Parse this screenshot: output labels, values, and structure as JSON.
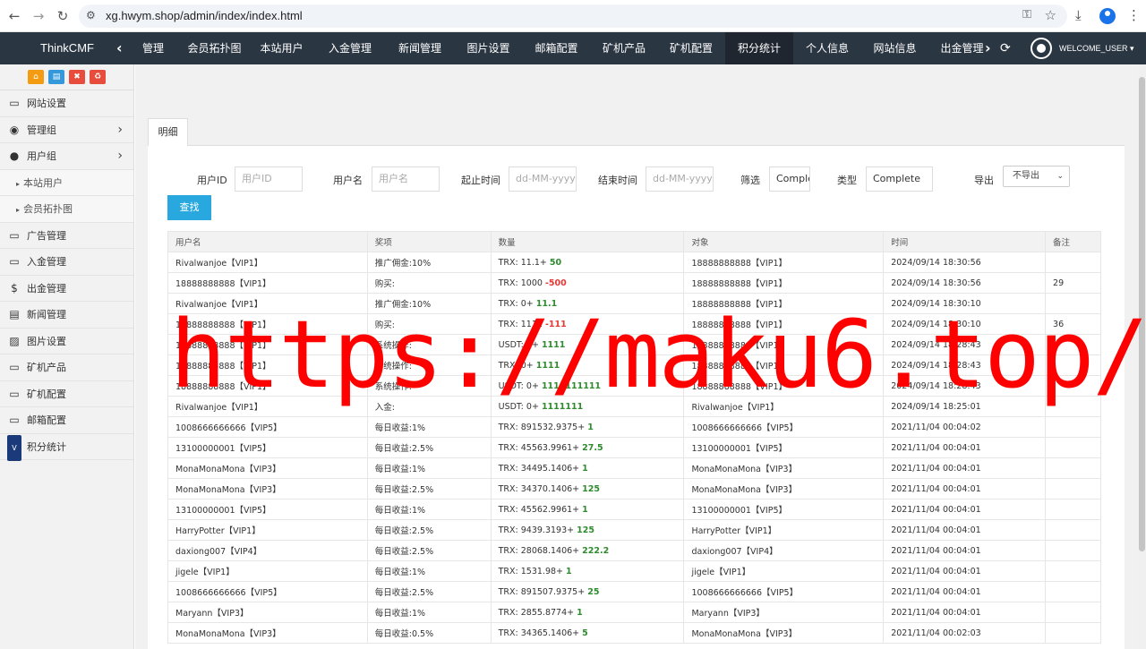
{
  "browser": {
    "url": "xg.hwym.shop/admin/index/index.html"
  },
  "topnav": {
    "brand": "ThinkCMF",
    "items": [
      {
        "label": "管理"
      },
      {
        "label": "会员拓扑图"
      },
      {
        "label": "本站用户"
      },
      {
        "label": "入金管理"
      },
      {
        "label": "新闻管理"
      },
      {
        "label": "图片设置"
      },
      {
        "label": "邮箱配置"
      },
      {
        "label": "矿机产品"
      },
      {
        "label": "矿机配置"
      },
      {
        "label": "积分统计",
        "active": true
      },
      {
        "label": "个人信息"
      },
      {
        "label": "网站信息"
      },
      {
        "label": "出金管理"
      }
    ],
    "welcome": "WELCOME_USER ▾"
  },
  "sidebar": {
    "quick_icons": [
      {
        "name": "home-icon",
        "color": "#f39c12",
        "glyph": "⌂"
      },
      {
        "name": "document-icon",
        "color": "#3498db",
        "glyph": "▤"
      },
      {
        "name": "trash-icon",
        "color": "#e74c3c",
        "glyph": "✖"
      },
      {
        "name": "recycle-icon",
        "color": "#e74c3c",
        "glyph": "♻"
      }
    ],
    "items": [
      {
        "label": "网站设置",
        "icon": "monitor-icon"
      },
      {
        "label": "管理组",
        "icon": "user-circle-icon"
      },
      {
        "label": "用户组",
        "icon": "user-icon"
      },
      {
        "label": "本站用户"
      },
      {
        "label": "会员拓扑图"
      },
      {
        "label": "广告管理",
        "icon": "monitor-icon"
      },
      {
        "label": "入金管理",
        "icon": "monitor-icon"
      },
      {
        "label": "出金管理",
        "icon": "dollar-icon"
      },
      {
        "label": "新闻管理",
        "icon": "newspaper-icon"
      },
      {
        "label": "图片设置",
        "icon": "image-icon"
      },
      {
        "label": "矿机产品",
        "icon": "monitor-icon"
      },
      {
        "label": "矿机配置",
        "icon": "monitor-icon"
      },
      {
        "label": "邮箱配置",
        "icon": "monitor-icon"
      },
      {
        "label": "积分统计",
        "icon": "visa-icon"
      }
    ]
  },
  "main": {
    "tab": "明细",
    "filters": {
      "user_id_label": "用户ID",
      "user_id_placeholder": "用户ID",
      "username_label": "用户名",
      "username_placeholder": "用户名",
      "start_label": "起止时间",
      "start_placeholder": "dd-MM-yyyy",
      "end_label": "结束时间",
      "end_placeholder": "dd-MM-yyyy",
      "filter_label": "筛选",
      "filter_value": "Comple",
      "type_label": "类型",
      "type_value": "Complete",
      "export_label": "导出",
      "export_value": "不导出"
    },
    "search_button": "查找",
    "table": {
      "headers": [
        "用户名",
        "奖项",
        "数量",
        "对象",
        "时间",
        "备注"
      ],
      "rows": [
        {
          "user": "Rivalwanjoe【VIP1】",
          "award": "推广佣金:10%",
          "qty_prefix": "TRX: 11.1+ ",
          "qty_delta": "50",
          "neg": false,
          "target": "18888888888【VIP1】",
          "time": "2024/09/14 18:30:56",
          "note": ""
        },
        {
          "user": "18888888888【VIP1】",
          "award": "购买:",
          "qty_prefix": "TRX: 1000 ",
          "qty_delta": "-500",
          "neg": true,
          "target": "18888888888【VIP1】",
          "time": "2024/09/14 18:30:56",
          "note": "29"
        },
        {
          "user": "Rivalwanjoe【VIP1】",
          "award": "推广佣金:10%",
          "qty_prefix": "TRX: 0+ ",
          "qty_delta": "11.1",
          "neg": false,
          "target": "18888888888【VIP1】",
          "time": "2024/09/14 18:30:10",
          "note": ""
        },
        {
          "user": "18888888888【VIP1】",
          "award": "购买:",
          "qty_prefix": "TRX: 1111 ",
          "qty_delta": "-111",
          "neg": true,
          "target": "18888888888【VIP1】",
          "time": "2024/09/14 18:30:10",
          "note": "36"
        },
        {
          "user": "18888888888【VIP1】",
          "award": "系统操作:",
          "qty_prefix": "USDT: 0+ ",
          "qty_delta": "1111",
          "neg": false,
          "target": "18888888888【VIP1】",
          "time": "2024/09/14 18:28:43",
          "note": ""
        },
        {
          "user": "18888888888【VIP1】",
          "award": "系统操作:",
          "qty_prefix": "TRX: 0+ ",
          "qty_delta": "1111",
          "neg": false,
          "target": "18888888888【VIP1】",
          "time": "2024/09/14 18:28:43",
          "note": ""
        },
        {
          "user": "18888888888【VIP1】",
          "award": "系统操作:",
          "qty_prefix": "USDT: 0+ ",
          "qty_delta": "1111111111",
          "neg": false,
          "target": "18888888888【VIP1】",
          "time": "2024/09/14 18:28:43",
          "note": ""
        },
        {
          "user": "Rivalwanjoe【VIP1】",
          "award": "入金:",
          "qty_prefix": "USDT: 0+ ",
          "qty_delta": "1111111",
          "neg": false,
          "target": "Rivalwanjoe【VIP1】",
          "time": "2024/09/14 18:25:01",
          "note": ""
        },
        {
          "user": "1008666666666【VIP5】",
          "award": "每日收益:1%",
          "qty_prefix": "TRX: 891532.9375+ ",
          "qty_delta": "1",
          "neg": false,
          "target": "1008666666666【VIP5】",
          "time": "2021/11/04 00:04:02",
          "note": ""
        },
        {
          "user": "13100000001【VIP5】",
          "award": "每日收益:2.5%",
          "qty_prefix": "TRX: 45563.9961+ ",
          "qty_delta": "27.5",
          "neg": false,
          "target": "13100000001【VIP5】",
          "time": "2021/11/04 00:04:01",
          "note": ""
        },
        {
          "user": "MonaMonaMona【VIP3】",
          "award": "每日收益:1%",
          "qty_prefix": "TRX: 34495.1406+ ",
          "qty_delta": "1",
          "neg": false,
          "target": "MonaMonaMona【VIP3】",
          "time": "2021/11/04 00:04:01",
          "note": ""
        },
        {
          "user": "MonaMonaMona【VIP3】",
          "award": "每日收益:2.5%",
          "qty_prefix": "TRX: 34370.1406+ ",
          "qty_delta": "125",
          "neg": false,
          "target": "MonaMonaMona【VIP3】",
          "time": "2021/11/04 00:04:01",
          "note": ""
        },
        {
          "user": "13100000001【VIP5】",
          "award": "每日收益:1%",
          "qty_prefix": "TRX: 45562.9961+ ",
          "qty_delta": "1",
          "neg": false,
          "target": "13100000001【VIP5】",
          "time": "2021/11/04 00:04:01",
          "note": ""
        },
        {
          "user": "HarryPotter【VIP1】",
          "award": "每日收益:2.5%",
          "qty_prefix": "TRX: 9439.3193+ ",
          "qty_delta": "125",
          "neg": false,
          "target": "HarryPotter【VIP1】",
          "time": "2021/11/04 00:04:01",
          "note": ""
        },
        {
          "user": "daxiong007【VIP4】",
          "award": "每日收益:2.5%",
          "qty_prefix": "TRX: 28068.1406+ ",
          "qty_delta": "222.2",
          "neg": false,
          "target": "daxiong007【VIP4】",
          "time": "2021/11/04 00:04:01",
          "note": ""
        },
        {
          "user": "jigele【VIP1】",
          "award": "每日收益:1%",
          "qty_prefix": "TRX: 1531.98+ ",
          "qty_delta": "1",
          "neg": false,
          "target": "jigele【VIP1】",
          "time": "2021/11/04 00:04:01",
          "note": ""
        },
        {
          "user": "1008666666666【VIP5】",
          "award": "每日收益:2.5%",
          "qty_prefix": "TRX: 891507.9375+ ",
          "qty_delta": "25",
          "neg": false,
          "target": "1008666666666【VIP5】",
          "time": "2021/11/04 00:04:01",
          "note": ""
        },
        {
          "user": "Maryann【VIP3】",
          "award": "每日收益:1%",
          "qty_prefix": "TRX: 2855.8774+ ",
          "qty_delta": "1",
          "neg": false,
          "target": "Maryann【VIP3】",
          "time": "2021/11/04 00:04:01",
          "note": ""
        },
        {
          "user": "MonaMonaMona【VIP3】",
          "award": "每日收益:0.5%",
          "qty_prefix": "TRX: 34365.1406+ ",
          "qty_delta": "5",
          "neg": false,
          "target": "MonaMonaMona【VIP3】",
          "time": "2021/11/04 00:02:03",
          "note": ""
        }
      ]
    }
  },
  "watermark": "https://maku6.top/"
}
